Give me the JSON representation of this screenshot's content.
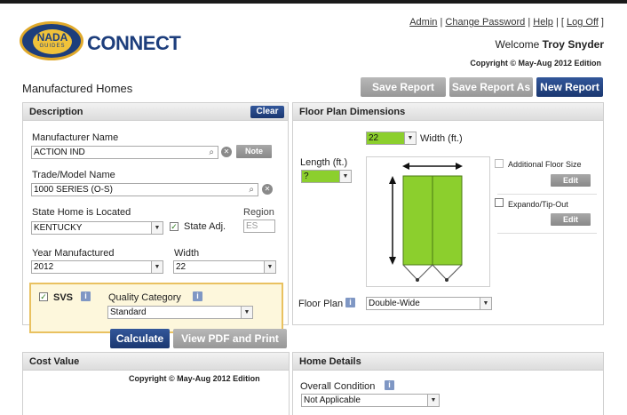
{
  "header": {
    "logo_nada": "NADA",
    "logo_guides": "GUIDES",
    "logo_connect": "CONNECT",
    "links": {
      "admin": "Admin",
      "change_password": "Change Password",
      "help": "Help",
      "logoff": "Log Off"
    },
    "welcome_prefix": "Welcome",
    "user_name": "Troy Snyder",
    "copyright": "Copyright © May-Aug 2012 Edition"
  },
  "page_title": "Manufactured Homes",
  "toolbar": {
    "save_report": "Save Report",
    "save_report_as": "Save Report As",
    "new_report": "New Report"
  },
  "description": {
    "title": "Description",
    "clear_label": "Clear",
    "manufacturer_label": "Manufacturer Name",
    "manufacturer_value": "ACTION IND",
    "note_label": "Note",
    "trade_label": "Trade/Model Name",
    "trade_value": "1000 SERIES (O-S)",
    "state_label": "State Home is Located",
    "state_value": "KENTUCKY",
    "state_adj_label": "State Adj.",
    "state_adj_checked": true,
    "region_label": "Region",
    "region_value": "ES",
    "year_label": "Year Manufactured",
    "year_value": "2012",
    "width_label": "Width",
    "width_value": "22",
    "svs_label": "SVS",
    "svs_checked": true,
    "quality_label": "Quality Category",
    "quality_value": "Standard"
  },
  "actions": {
    "calculate": "Calculate",
    "view_pdf": "View PDF and Print"
  },
  "floor_plan": {
    "title": "Floor Plan Dimensions",
    "width_value": "22",
    "width_label": "Width (ft.)",
    "length_label": "Length (ft.)",
    "length_value": "?",
    "additional_floor_label": "Additional Floor Size",
    "additional_floor_checked": false,
    "edit_label": "Edit",
    "expando_label": "Expando/Tip-Out",
    "expando_checked": false,
    "floor_plan_label": "Floor Plan",
    "floor_plan_value": "Double-Wide",
    "home_color": "#8ccf2d"
  },
  "cost_value": {
    "title": "Cost Value",
    "copyright": "Copyright © May-Aug 2012 Edition"
  },
  "home_details": {
    "title": "Home Details",
    "condition_label": "Overall Condition",
    "condition_value": "Not Applicable"
  },
  "colors": {
    "brand_blue": "#1a3770",
    "field_green": "#8ccf2d",
    "svs_bg": "#fdf7dc"
  }
}
